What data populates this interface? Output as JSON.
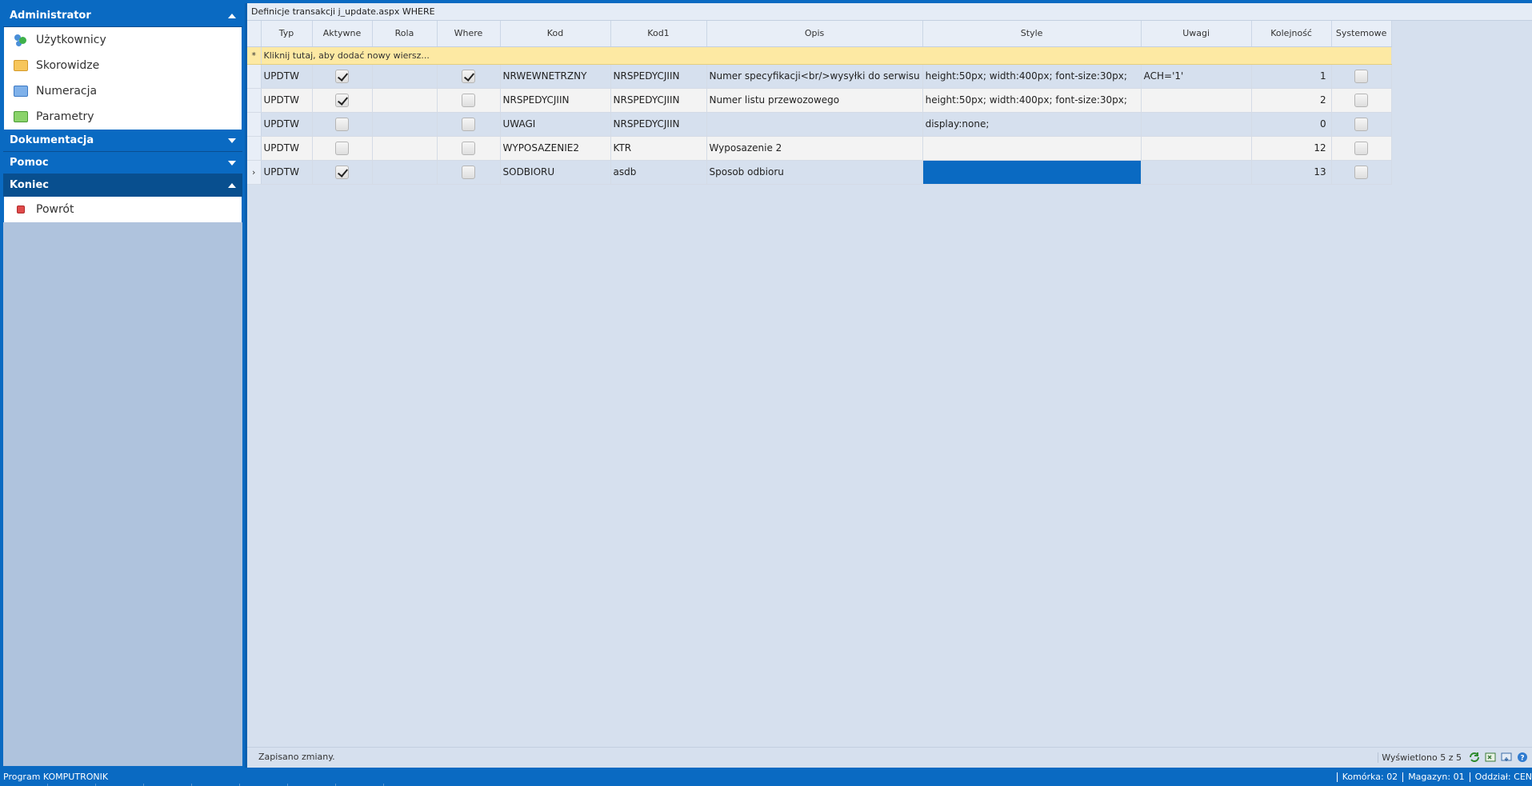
{
  "sidebar": {
    "sections": [
      {
        "title": "Administrator",
        "expanded": true,
        "items": [
          {
            "label": "Użytkownicy",
            "icon": "users-icon"
          },
          {
            "label": "Skorowidze",
            "icon": "folder-icon"
          },
          {
            "label": "Numeracja",
            "icon": "folder-icon"
          },
          {
            "label": "Parametry",
            "icon": "folder-icon"
          }
        ]
      },
      {
        "title": "Dokumentacja",
        "expanded": false
      },
      {
        "title": "Pomoc",
        "expanded": false
      },
      {
        "title": "Koniec",
        "expanded": true,
        "items": [
          {
            "label": "Powrót",
            "icon": "exit-icon"
          }
        ]
      }
    ]
  },
  "main": {
    "title": "Definicje transakcji j_update.aspx WHERE",
    "new_row_text": "Kliknij tutaj, aby dodać nowy wiersz...",
    "new_row_marker": "*",
    "columns": [
      "Typ",
      "Aktywne",
      "Rola",
      "Where",
      "Kod",
      "Kod1",
      "Opis",
      "Style",
      "Uwagi",
      "Kolejność",
      "Systemowe"
    ],
    "rows": [
      {
        "typ": "UPDTW",
        "aktywne": true,
        "rola": "",
        "where": true,
        "kod": "NRWEWNETRZNY",
        "kod1": "NRSPEDYCJIIN",
        "opis": "Numer specyfikacji<br/>wysyłki do serwisu",
        "style": "height:50px; width:400px; font-size:30px;",
        "uwagi": "ACH='1'",
        "kolejnosc": "1",
        "systemowe": false
      },
      {
        "typ": "UPDTW",
        "aktywne": true,
        "rola": "",
        "where": false,
        "kod": "NRSPEDYCJIIN",
        "kod1": "NRSPEDYCJIIN",
        "opis": "Numer listu przewozowego",
        "style": "height:50px; width:400px; font-size:30px;",
        "uwagi": "",
        "kolejnosc": "2",
        "systemowe": false
      },
      {
        "typ": "UPDTW",
        "aktywne": false,
        "rola": "",
        "where": false,
        "kod": "UWAGI",
        "kod1": "NRSPEDYCJIIN",
        "opis": "",
        "style": "display:none;",
        "uwagi": "",
        "kolejnosc": "0",
        "systemowe": false
      },
      {
        "typ": "UPDTW",
        "aktywne": false,
        "rola": "",
        "where": false,
        "kod": "WYPOSAZENIE2",
        "kod1": "KTR",
        "opis": "Wyposazenie 2",
        "style": "",
        "uwagi": "",
        "kolejnosc": "12",
        "systemowe": false
      },
      {
        "typ": "UPDTW",
        "aktywne": true,
        "rola": "",
        "where": false,
        "kod": "SODBIORU",
        "kod1": "asdb",
        "opis": "Sposob odbioru",
        "style": "",
        "uwagi": "",
        "kolejnosc": "13",
        "systemowe": false,
        "current": true,
        "selected_cell": "style"
      }
    ],
    "current_row_marker": "›",
    "status": "Zapisano zmiany.",
    "count_text": "Wyświetlono 5 z 5",
    "toolbar_icons": [
      "refresh-icon",
      "export-excel-icon",
      "export-icon",
      "help-icon"
    ]
  },
  "footer": {
    "program": "Program KOMPUTRONIK",
    "komorka_label": "Komórka:",
    "komorka_value": "02",
    "magazyn_label": "Magazyn:",
    "magazyn_value": "01",
    "oddzial_label": "Oddział:",
    "oddzial_value": "CEN"
  },
  "colors": {
    "accent": "#0a6ac2",
    "accent_dark": "#084f8f",
    "sidebar_bg": "#afc3dd",
    "main_bg": "#d6e0ee",
    "new_row": "#fde9a3"
  }
}
